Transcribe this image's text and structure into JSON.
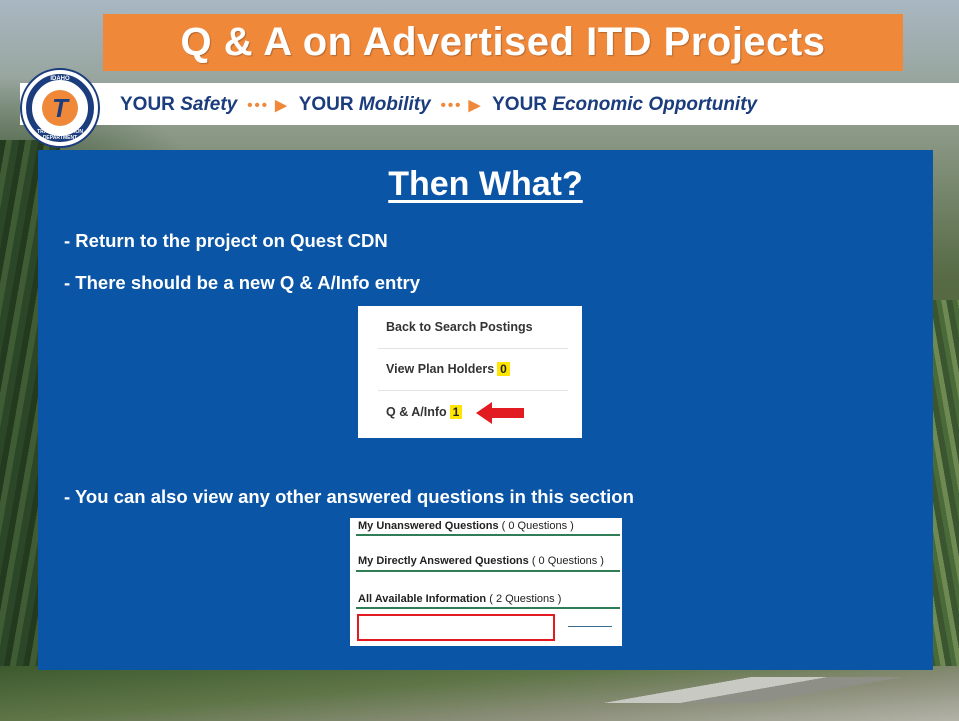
{
  "slide": {
    "title": "Q & A on Advertised ITD Projects",
    "tagline": {
      "part1_word": "YOUR",
      "part1_em": "Safety",
      "part2_word": "YOUR",
      "part2_em": "Mobility",
      "part3_word": "YOUR",
      "part3_em": "Economic Opportunity",
      "arrow": "••• ▶"
    },
    "logo": {
      "top_text": "IDAHO",
      "center_letter": "T",
      "bottom_text": "TRANSPORTATION DEPARTMENT",
      "icon": "itd-logo-icon"
    },
    "heading": "Then What?",
    "bullets": [
      "- Return to the project on Quest CDN",
      "- There should be a new Q & A/Info entry",
      "- You can also view any other answered questions in this section"
    ]
  },
  "menu_screenshot": {
    "items": [
      {
        "label": "Back to Search Postings",
        "count": ""
      },
      {
        "label": "View Plan Holders",
        "count": "0"
      },
      {
        "label": "Q & A/Info",
        "count": "1"
      }
    ],
    "pointer_icon": "red-arrow-left-icon"
  },
  "questions_screenshot": {
    "rows": [
      {
        "label": "My Unanswered Questions",
        "detail": "( 0 Questions )"
      },
      {
        "label": "My Directly Answered Questions",
        "detail": "( 0 Questions )"
      },
      {
        "label": "All Available Information",
        "detail": "( 2 Questions )"
      }
    ],
    "highlight_color": "#e21b22"
  },
  "colors": {
    "title_bg": "#f0883a",
    "panel_bg": "#0b55a6",
    "tagline_text": "#1b3c7d",
    "badge_bg": "#ffe500"
  }
}
